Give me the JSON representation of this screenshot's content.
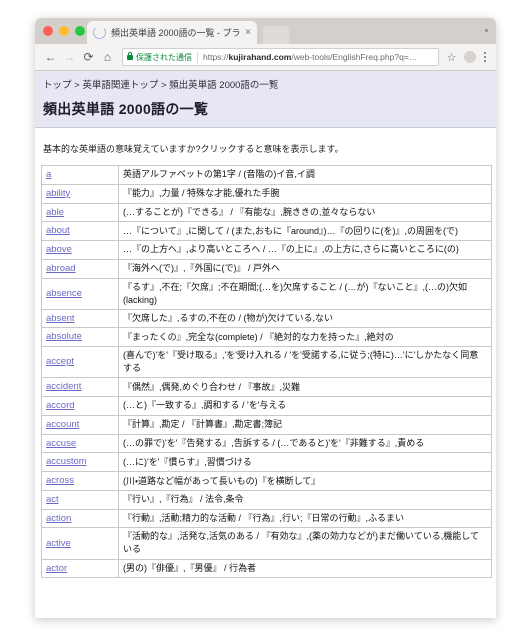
{
  "browser": {
    "tab": {
      "title": "頻出英単語 2000語の一覧 - プラ",
      "close_label": "×",
      "favicon": "loading-spinner-icon"
    },
    "toolbar": {
      "back_label": "←",
      "forward_label": "→",
      "reload_label": "⟳",
      "home_label": "⌂",
      "secure_label": "保護された通信",
      "url_prefix": "https://",
      "url_domain": "kujirahand.com",
      "url_path": "/web-tools/EnglishFreq.php?q=…",
      "star_label": "☆"
    }
  },
  "page": {
    "breadcrumb": "トップ > 英単語関連トップ > 頻出英単語 2000語の一覧",
    "title": "頻出英単語 2000語の一覧",
    "intro": "基本的な英単語の意味覚えていますか?クリックすると意味を表示します。",
    "rows": [
      {
        "word": "a",
        "meaning": "英語アルファベットの第1字 / (音階の)イ音,イ調"
      },
      {
        "word": "ability",
        "meaning": "『能力』,力量 / 特殊な才能,優れた手腕"
      },
      {
        "word": "able",
        "meaning": "(…することが)『できる』 / 『有能な』,腕ききの,並々ならない"
      },
      {
        "word": "about",
        "meaning": "…『について』,に関して / (また,おもに『around』)…『の回りに(を)』,の周囲を(で)"
      },
      {
        "word": "above",
        "meaning": "…『の上方へ』,より高いところへ / …『の上に』,の上方に,さらに高いところに(の)"
      },
      {
        "word": "abroad",
        "meaning": "『海外へ(で)』,『外国に(で)』 / 戸外へ"
      },
      {
        "word": "absence",
        "meaning": "『るす』,不在;『欠席』;不在期間;(…を)欠席すること / (…が)『ないこと』,(…の)欠如(lacking)"
      },
      {
        "word": "absent",
        "meaning": "『欠席した』,るすの,不在の / (物が)欠けている,ない"
      },
      {
        "word": "absolute",
        "meaning": "『まったくの』,完全な(complete) / 『絶対的な力を持った』,絶対の"
      },
      {
        "word": "accept",
        "meaning": "(喜んで)'を'『受け取る』,'を'受け入れる / 'を'受諾する,に従う;(特に)…'に'しかたなく同意する"
      },
      {
        "word": "accident",
        "meaning": "『偶然』,偶発,めぐり合わせ / 『事故』,災難"
      },
      {
        "word": "accord",
        "meaning": "(…と)『一致する』,調和する / 'を'与える"
      },
      {
        "word": "account",
        "meaning": "『計算』,勘定 / 『計算書』,勘定書;簿記"
      },
      {
        "word": "accuse",
        "meaning": "(…の罪で)'を'『告発する』,告訴する / (…であると)'を'『非難する』,責める"
      },
      {
        "word": "accustom",
        "meaning": "(…に)'を'『慣らす』,習慣づける"
      },
      {
        "word": "across",
        "meaning": "(川・道路など幅があって長いもの)『を横断して』"
      },
      {
        "word": "act",
        "meaning": "『行い』,『行為』 / 法令,条令"
      },
      {
        "word": "action",
        "meaning": "『行動』,活動;精力的な活動 / 『行為』,行い;『日常の行動』,ふるまい"
      },
      {
        "word": "active",
        "meaning": "『活動的な』,活発な,活気のある / 『有効な』,(薬の効力などが)まだ働いている,機能している"
      },
      {
        "word": "actor",
        "meaning": "(男の)『俳優』,『男優』 / 行為者"
      }
    ]
  }
}
